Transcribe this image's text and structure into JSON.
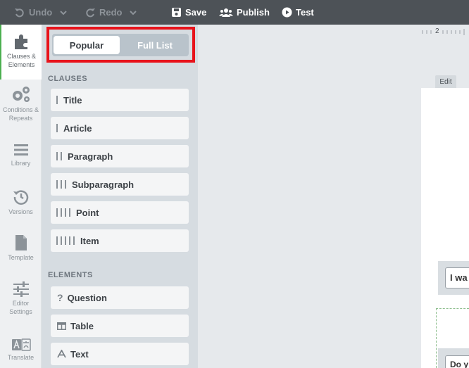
{
  "toolbar": {
    "undo_label": "Undo",
    "redo_label": "Redo",
    "save_label": "Save",
    "publish_label": "Publish",
    "test_label": "Test"
  },
  "rail": {
    "items": [
      {
        "label_line1": "Clauses &",
        "label_line2": "Elements",
        "icon": "puzzle-icon",
        "active": true
      },
      {
        "label_line1": "Conditions &",
        "label_line2": "Repeats",
        "icon": "gears-icon"
      },
      {
        "label_line1": "Library",
        "label_line2": "",
        "icon": "hamburger-icon"
      },
      {
        "label_line1": "Versions",
        "label_line2": "",
        "icon": "history-icon"
      },
      {
        "label_line1": "Template",
        "label_line2": "",
        "icon": "document-icon"
      },
      {
        "label_line1": "Editor",
        "label_line2": "Settings",
        "icon": "sliders-icon"
      },
      {
        "label_line1": "Translate",
        "label_line2": "",
        "icon": "translate-icon"
      }
    ]
  },
  "panel": {
    "tabs": {
      "popular": "Popular",
      "full_list": "Full List",
      "selected": "Popular"
    },
    "clauses_title": "CLAUSES",
    "clauses": [
      {
        "label": "Title",
        "level": 1
      },
      {
        "label": "Article",
        "level": 1
      },
      {
        "label": "Paragraph",
        "level": 2
      },
      {
        "label": "Subparagraph",
        "level": 3
      },
      {
        "label": "Point",
        "level": 4
      },
      {
        "label": "Item",
        "level": 5
      }
    ],
    "elements_title": "ELEMENTS",
    "elements": [
      {
        "label": "Question",
        "icon": "question-icon"
      },
      {
        "label": "Table",
        "icon": "table-icon"
      },
      {
        "label": "Text",
        "icon": "text-icon"
      }
    ]
  },
  "canvas": {
    "ruler_mark": "2",
    "edit_tab": "Edit",
    "question_field_1": "I wa",
    "question_field_2": "Do y"
  },
  "colors": {
    "toolbar_bg": "#4d5257",
    "highlight": "#e8131b",
    "active_accent": "#4caf50",
    "panel_bg": "#d6dce1"
  }
}
